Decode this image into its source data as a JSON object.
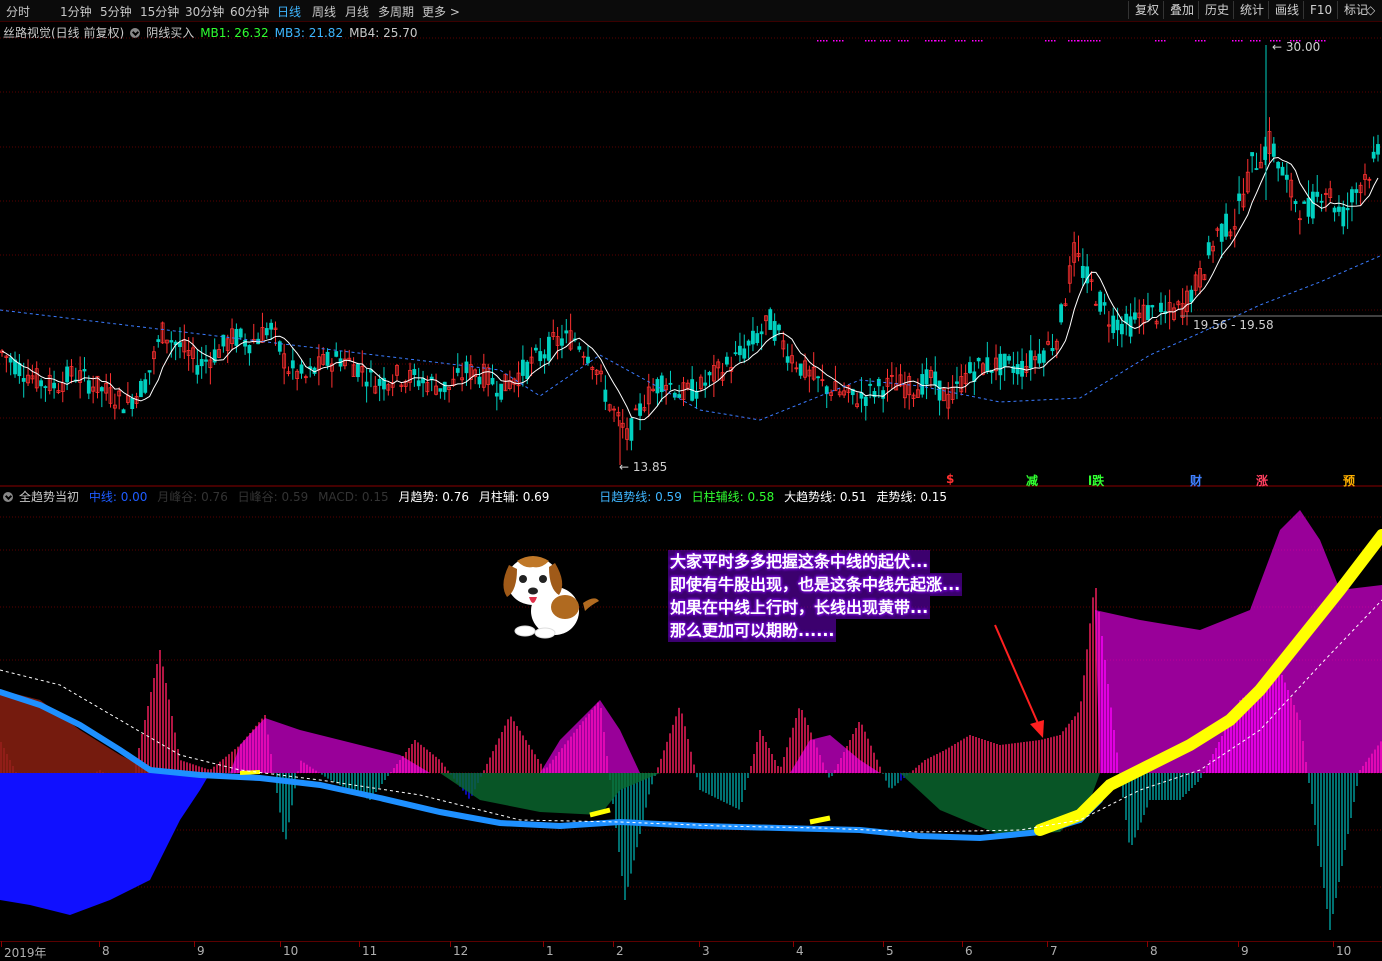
{
  "toolbar": {
    "periods": [
      "分时",
      "1分钟",
      "5分钟",
      "15分钟",
      "30分钟",
      "60分钟",
      "日线",
      "周线",
      "月线",
      "多周期",
      "更多 >"
    ],
    "active_period": "日线",
    "right_buttons": [
      "复权",
      "叠加",
      "历史",
      "统计",
      "画线",
      "F10",
      "标记",
      "◇"
    ]
  },
  "main_legend": {
    "title": "丝路视觉(日线 前复权)",
    "indicator": "阴线买入",
    "mb1": "MB1: 26.32",
    "mb3": "MB3: 21.82",
    "mb4": "MB4: 25.70"
  },
  "price_labels": {
    "high": "30.00",
    "low": "13.85",
    "range": "19.56 - 19.58"
  },
  "signals": [
    {
      "text": "$",
      "color": "#ff3030"
    },
    {
      "text": "减",
      "color": "#30ff30"
    },
    {
      "text": "l跌",
      "color": "#30ff30"
    },
    {
      "text": "财",
      "color": "#4080ff"
    },
    {
      "text": "涨",
      "color": "#ff4060"
    },
    {
      "text": "预",
      "color": "#ffb000"
    }
  ],
  "sub_legend": {
    "title": "全趋势当初",
    "items": [
      {
        "text": "中线: 0.00",
        "color": "#1e5cff"
      },
      {
        "text": "月峰谷: 0.76",
        "color": "#333333"
      },
      {
        "text": "日峰谷: 0.59",
        "color": "#333333"
      },
      {
        "text": "MACD: 0.15",
        "color": "#333333"
      },
      {
        "text": "月趋势: 0.76",
        "color": "#ffffff"
      },
      {
        "text": "月柱辅: 0.69",
        "color": "#ffffff"
      },
      {
        "text": "日趋势线: 0.59",
        "color": "#3fb6ff"
      },
      {
        "text": "日柱辅线: 0.58",
        "color": "#30ff30"
      },
      {
        "text": "大趋势线: 0.51",
        "color": "#ffffff"
      },
      {
        "text": "走势线: 0.15",
        "color": "#ffffff"
      }
    ]
  },
  "annotation": [
    "大家平时多多把握这条中线的起伏...",
    "即使有牛股出现，也是这条中线先起涨...",
    "如果在中线上行时，长线出现黄带...",
    "那么更加可以期盼......"
  ],
  "xaxis": [
    "2019年",
    "8",
    "9",
    "10",
    "11",
    "12",
    "1",
    "2",
    "3",
    "4",
    "5",
    "6",
    "7",
    "8",
    "9",
    "10"
  ],
  "colors": {
    "up": "#ff3030",
    "down": "#00d0c0",
    "ma": "#ffffff",
    "trend": "#3a7bff",
    "yellow": "#ffff00",
    "magenta": "#ff00ff",
    "crimson": "#ff2060",
    "teal": "#00a0a0",
    "blue": "#1010ff"
  },
  "chart_data": {
    "type": "candlestick",
    "price_range_visible": [
      "13.85",
      "30.00"
    ],
    "close_trace": [
      18.2,
      17.6,
      17.1,
      16.9,
      17.4,
      17.0,
      16.6,
      16.2,
      17.0,
      19.0,
      18.4,
      17.7,
      18.2,
      18.8,
      18.6,
      19.2,
      17.6,
      17.2,
      17.8,
      18.0,
      17.6,
      17.0,
      17.3,
      17.2,
      17.0,
      16.8,
      17.5,
      17.3,
      16.8,
      17.4,
      18.0,
      18.6,
      18.8,
      18.0,
      16.2,
      14.9,
      16.4,
      17.2,
      16.6,
      16.8,
      17.4,
      17.9,
      18.6,
      19.4,
      18.2,
      17.4,
      16.9,
      16.6,
      16.4,
      16.8,
      17.0,
      16.8,
      17.2,
      16.3,
      17.4,
      17.7,
      17.7,
      17.6,
      18.1,
      18.7,
      22.0,
      20.7,
      19.5,
      19.2,
      19.8,
      19.6,
      19.9,
      21.0,
      22.8,
      23.3,
      25.5,
      26.3,
      24.5,
      23.5,
      24.7,
      23.4,
      24.8,
      25.7
    ]
  }
}
